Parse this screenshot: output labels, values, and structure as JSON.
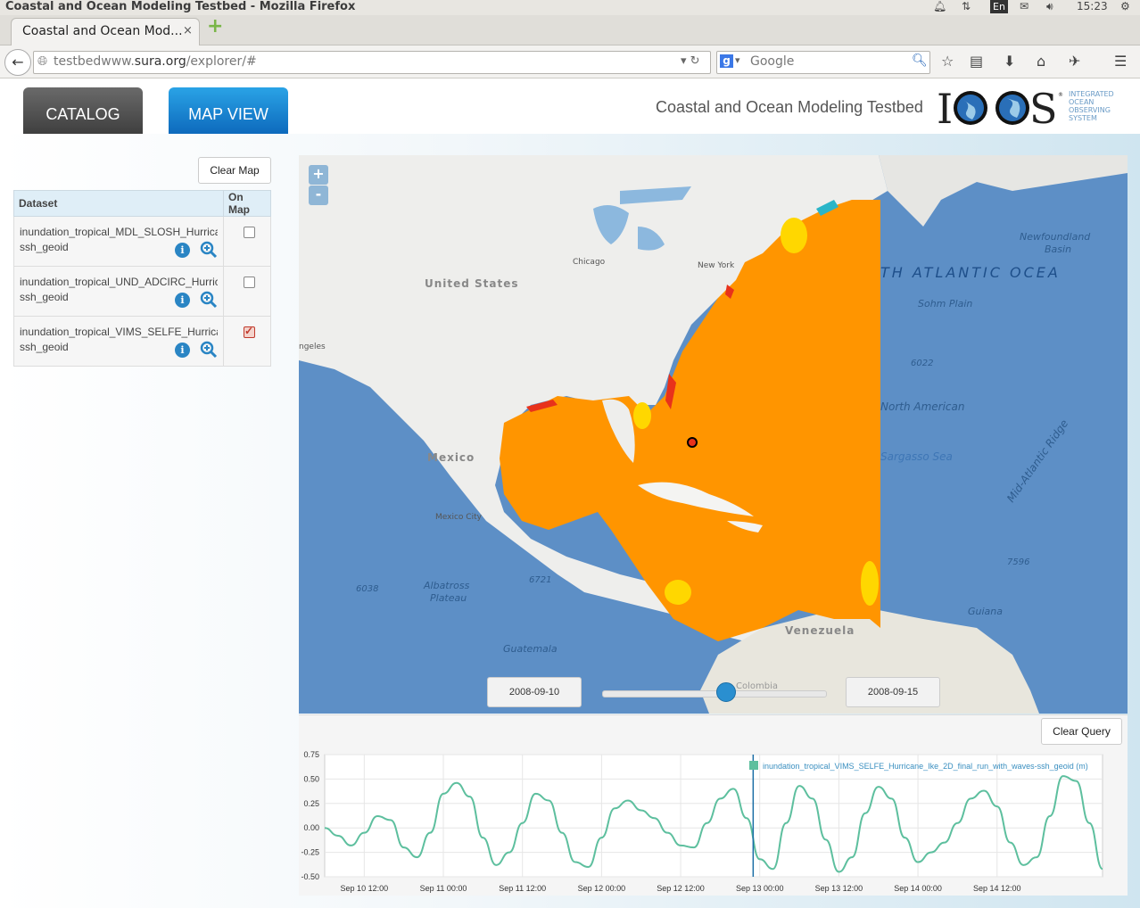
{
  "os": {
    "window_title": "Coastal and Ocean Modeling Testbed - Mozilla Firefox",
    "lang": "En",
    "clock": "15:23"
  },
  "browser": {
    "tab_title": "Coastal and Ocean Mod...",
    "tab_close": "×",
    "new_tab": "+",
    "url_prefix": "testbedwww.",
    "url_domain": "sura.org",
    "url_path": "/explorer/#",
    "search_placeholder": "Google",
    "search_engine_glyph": "g"
  },
  "app": {
    "tabs": [
      "CATALOG",
      "MAP VIEW"
    ],
    "active_tab": "MAP VIEW",
    "title": "Coastal and Ocean Modeling Testbed",
    "logo_text": "IOOS",
    "logo_tagline": [
      "INTEGRATED",
      "OCEAN",
      "OBSERVING",
      "SYSTEM"
    ]
  },
  "sidebar": {
    "clear_map": "Clear Map",
    "table_headers": [
      "Dataset",
      "On Map"
    ],
    "datasets": [
      {
        "name": "inundation_tropical_MDL_SLOSH_Hurricane_Ike",
        "variable": "ssh_geoid",
        "on_map": false
      },
      {
        "name": "inundation_tropical_UND_ADCIRC_Hurricane_Ike",
        "variable": "ssh_geoid",
        "on_map": false
      },
      {
        "name": "inundation_tropical_VIMS_SELFE_Hurricane_Ike",
        "variable": "ssh_geoid",
        "on_map": true
      }
    ]
  },
  "map": {
    "zoom_in": "+",
    "zoom_out": "-",
    "labels": [
      "United States",
      "Mexico",
      "Mexico City",
      "Chicago",
      "New York",
      "Venezuela",
      "Colombia",
      "ngeles",
      "TH  ATLANTIC  OCEA",
      "Newfoundland",
      "Basin",
      "Sohm Plain",
      "6022",
      "North American",
      "Sargasso Sea",
      "Mid-Atlantic Ridge",
      "7596",
      "Guiana",
      "6038",
      "Albatross",
      "Plateau",
      "6721",
      "Guatemala"
    ],
    "colors": {
      "ocean": "#5d8fc6",
      "land": "#eeeeec",
      "overlay": "#ff9500",
      "overlay_high": "#ffd700",
      "overlay_low": "#e8321b"
    },
    "time_start": "2008-09-10",
    "time_end": "2008-09-15",
    "slider_fraction": 0.55
  },
  "chart_panel": {
    "clear_query": "Clear Query"
  },
  "chart_data": {
    "type": "line",
    "series": [
      {
        "name": "inundation_tropical_VIMS_SELFE_Hurricane_Ike_2D_final_run_with_waves-ssh_geoid (m)",
        "color": "#5dbf9e",
        "x": [
          0,
          2,
          4,
          6,
          8,
          10,
          12,
          14,
          16,
          18,
          20,
          22,
          24,
          26,
          28,
          30,
          32,
          34,
          36,
          38,
          40,
          42,
          44,
          46,
          48,
          50,
          52,
          54,
          56,
          58,
          60,
          62,
          64,
          66,
          68,
          70,
          72,
          74,
          76,
          78,
          80,
          82,
          84,
          86,
          88,
          90,
          92,
          94,
          96,
          98,
          100,
          102,
          104,
          106,
          108,
          110,
          112,
          114,
          116,
          118
        ],
        "y": [
          0.0,
          -0.08,
          -0.18,
          -0.05,
          0.12,
          0.08,
          -0.2,
          -0.3,
          -0.05,
          0.35,
          0.46,
          0.32,
          -0.1,
          -0.38,
          -0.25,
          0.05,
          0.35,
          0.28,
          -0.05,
          -0.35,
          -0.4,
          -0.1,
          0.2,
          0.28,
          0.18,
          0.1,
          -0.05,
          -0.18,
          -0.2,
          0.05,
          0.3,
          0.4,
          0.1,
          -0.32,
          -0.42,
          0.05,
          0.43,
          0.3,
          -0.12,
          -0.45,
          -0.3,
          0.15,
          0.42,
          0.3,
          -0.1,
          -0.35,
          -0.25,
          -0.15,
          0.05,
          0.3,
          0.38,
          0.22,
          -0.15,
          -0.38,
          -0.3,
          0.12,
          0.53,
          0.48,
          0.05,
          -0.42
        ]
      }
    ],
    "x_start": "2008-09-10T06:00",
    "x_unit": "hours",
    "x_ticks": [
      "Sep 10 12:00",
      "Sep 11 00:00",
      "Sep 11 12:00",
      "Sep 12 00:00",
      "Sep 12 12:00",
      "Sep 13 00:00",
      "Sep 13 12:00",
      "Sep 14 00:00",
      "Sep 14 12:00"
    ],
    "x_tick_positions": [
      6,
      18,
      30,
      42,
      54,
      66,
      78,
      90,
      102
    ],
    "x_range": [
      0,
      118
    ],
    "y_ticks": [
      "0.75",
      "0.50",
      "0.25",
      "0.00",
      "-0.25",
      "-0.50"
    ],
    "y_range": [
      -0.5,
      0.75
    ],
    "cursor_x": 65,
    "grid": true,
    "legend_position": "top-right"
  }
}
